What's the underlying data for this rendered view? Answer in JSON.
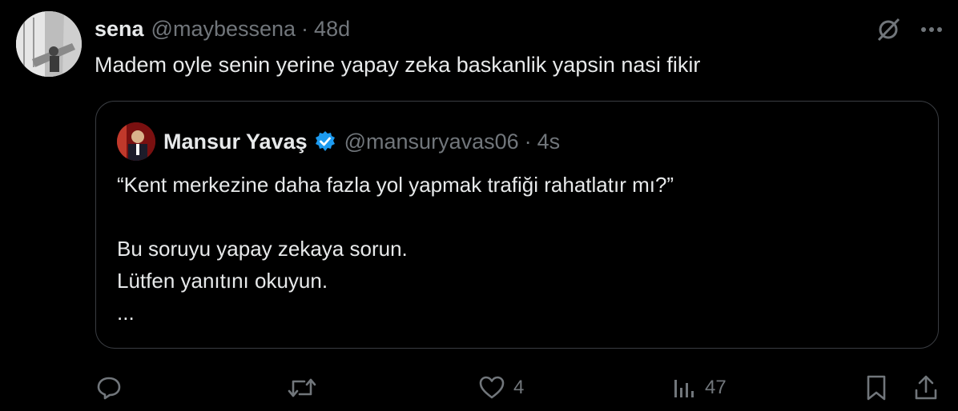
{
  "tweet": {
    "author_name": "sena",
    "handle": "@maybessena",
    "separator": "·",
    "time": "48d",
    "text": "Madem oyle senin yerine yapay zeka baskanlik yapsin nasi fikir"
  },
  "quoted": {
    "author_name": "Mansur Yavaş",
    "handle": "@mansuryavas06",
    "separator": "·",
    "time": "4s",
    "lines": [
      "“Kent merkezine daha fazla yol yapmak trafiği rahatlatır mı?”",
      "",
      "Bu soruyu yapay zekaya sorun.",
      "Lütfen yanıtını okuyun.",
      "..."
    ]
  },
  "actions": {
    "reply_count": "",
    "repost_count": "",
    "like_count": "4",
    "views_count": "47"
  },
  "icons": [
    "grok-icon",
    "more-icon",
    "verified-badge-icon",
    "reply-icon",
    "repost-icon",
    "like-icon",
    "views-icon",
    "bookmark-icon",
    "share-icon"
  ],
  "colors": {
    "background": "#000000",
    "text": "#e7e9ea",
    "muted": "#71767b",
    "border": "#3a3d42",
    "verified": "#1d9bf0"
  }
}
